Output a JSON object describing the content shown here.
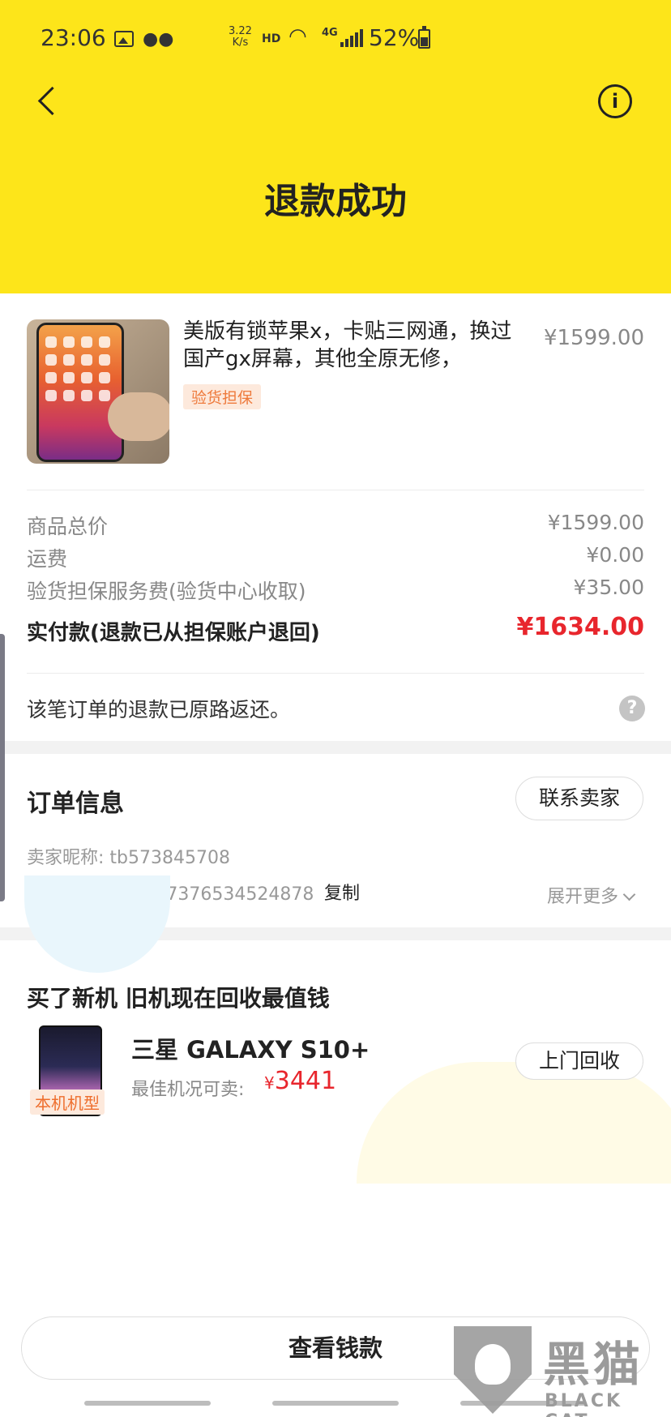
{
  "status_bar": {
    "time": "23:06",
    "speed_top": "3.22",
    "speed_bottom": "K/s",
    "hd": "HD",
    "network": "4G",
    "battery": "52%",
    "icons": [
      "image-icon",
      "wechat-icon",
      "wifi-icon",
      "signal-icon",
      "battery-icon"
    ]
  },
  "header": {
    "title": "退款成功",
    "bg_color": "#fde51a"
  },
  "product": {
    "title": "美版有锁苹果x，卡贴三网通，换过国产gx屏幕，其他全原无修，",
    "price": "¥1599.00",
    "tag": "验货担保"
  },
  "fees": {
    "goods_total_label": "商品总价",
    "goods_total_value": "¥1599.00",
    "shipping_label": "运费",
    "shipping_value": "¥0.00",
    "inspection_label": "验货担保服务费(验货中心收取)",
    "inspection_value": "¥35.00",
    "paid_label": "实付款(退款已从担保账户退回)",
    "paid_value": "¥1634.00",
    "accent_color": "#e8262d"
  },
  "refund_note": "该笔订单的退款已原路返还。",
  "order_info": {
    "title": "订单信息",
    "contact_button": "联系卖家",
    "seller_nick": "卖家昵称: tb573845708",
    "order_number": "订单编号: 948337376534524878",
    "copy_button": "复制",
    "expand_more": "展开更多"
  },
  "recycle": {
    "title": "买了新机 旧机现在回收最值钱",
    "model_badge": "本机机型",
    "model_name": "三星 GALAXY S10+",
    "best_label": "最佳机况可卖:",
    "currency": "¥",
    "best_price": "3441",
    "button": "上门回收"
  },
  "bottom": {
    "view_money_button": "查看钱款"
  },
  "watermark": {
    "text": "黑猫",
    "sub": "BLACK CAT"
  }
}
